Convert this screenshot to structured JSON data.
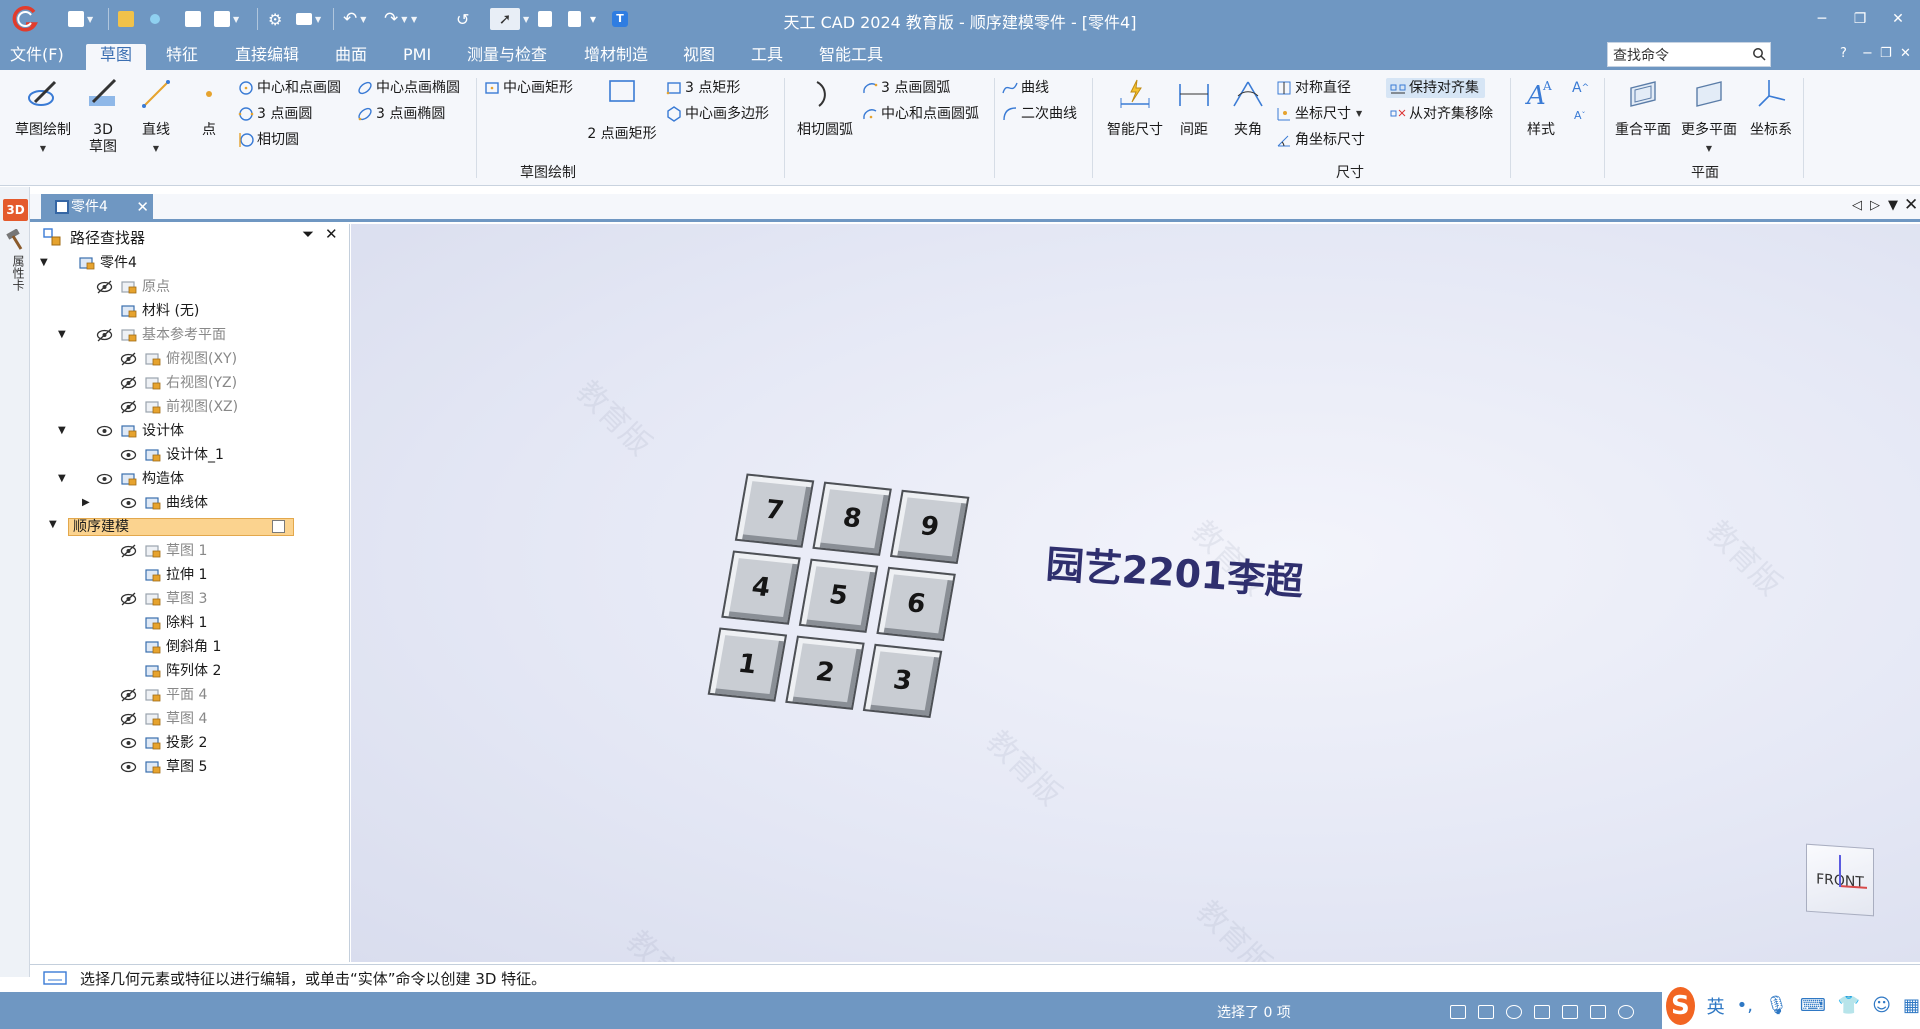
{
  "titlebar": {
    "title": "天工 CAD 2024 教育版 - 顺序建模零件 - [零件4]",
    "window_controls": [
      "minimize",
      "restore",
      "close"
    ]
  },
  "menu": {
    "file": "文件(F)",
    "tabs": [
      "草图",
      "特征",
      "直接编辑",
      "曲面",
      "PMI",
      "测量与检查",
      "增材制造",
      "视图",
      "工具",
      "智能工具"
    ],
    "active_tab": "草图",
    "search_placeholder": "查找命令",
    "help": "?"
  },
  "ribbon": {
    "sketch_draw": {
      "label": "草图绘制",
      "big": [
        {
          "id": "sketch",
          "label": "草图绘制"
        },
        {
          "id": "3d",
          "label": "3D\n草图"
        },
        {
          "id": "line",
          "label": "直线"
        },
        {
          "id": "point",
          "label": "点"
        }
      ],
      "circle_small": [
        "中心和点画圆",
        "3 点画圆",
        "相切圆"
      ],
      "ellipse_small": [
        "中心点画椭圆",
        "3 点画椭圆"
      ],
      "rect_small": [
        "中心画矩形"
      ],
      "rect_big": "2 点画矩形",
      "rect_more": [
        "3 点矩形",
        "中心画多边形"
      ],
      "arc_big": "相切圆弧",
      "arc_small": [
        "3 点画圆弧",
        "中心和点画圆弧"
      ],
      "curve_small": [
        "曲线",
        "二次曲线"
      ]
    },
    "dimension": {
      "label": "尺寸",
      "big": [
        "智能尺寸",
        "间距",
        "夹角"
      ],
      "small": [
        "对称直径",
        "坐标尺寸",
        "角坐标尺寸"
      ],
      "align": [
        "保持对齐集",
        "从对齐集移除"
      ]
    },
    "style": {
      "label": "样式"
    },
    "plane": {
      "label": "平面",
      "big": [
        "重合平面",
        "更多平面",
        "坐标系"
      ]
    }
  },
  "left_rail": {
    "badge": "3D",
    "label": "属性卡"
  },
  "doc_tab": {
    "name": "零件4"
  },
  "pathfinder": {
    "title": "路径查找器",
    "tree": [
      {
        "label": "零件4",
        "depth": 0,
        "exp": "▼",
        "eye": "none",
        "muted": false
      },
      {
        "label": "原点",
        "depth": 1,
        "exp": "",
        "eye": "hidden",
        "muted": true
      },
      {
        "label": "材料 (无)",
        "depth": 1,
        "exp": "",
        "eye": "none",
        "muted": false
      },
      {
        "label": "基本参考平面",
        "depth": 1,
        "exp": "▼",
        "eye": "hidden",
        "muted": true
      },
      {
        "label": "俯视图(XY)",
        "depth": 2,
        "exp": "",
        "eye": "hidden",
        "muted": true
      },
      {
        "label": "右视图(YZ)",
        "depth": 2,
        "exp": "",
        "eye": "hidden",
        "muted": true
      },
      {
        "label": "前视图(XZ)",
        "depth": 2,
        "exp": "",
        "eye": "hidden",
        "muted": true
      },
      {
        "label": "设计体",
        "depth": 1,
        "exp": "▼",
        "eye": "visible",
        "muted": false
      },
      {
        "label": "设计体_1",
        "depth": 2,
        "exp": "",
        "eye": "visible",
        "muted": false
      },
      {
        "label": "构造体",
        "depth": 1,
        "exp": "▼",
        "eye": "visible",
        "muted": false
      },
      {
        "label": "曲线体",
        "depth": 2,
        "exp": "▶",
        "eye": "visible",
        "muted": false
      },
      {
        "label": "顺序建模",
        "depth": 1,
        "exp": "▼",
        "eye": "none",
        "muted": false,
        "selected": true
      },
      {
        "label": "草图 1",
        "depth": 2,
        "exp": "",
        "eye": "hidden",
        "muted": true
      },
      {
        "label": "拉伸 1",
        "depth": 2,
        "exp": "",
        "eye": "none",
        "muted": false
      },
      {
        "label": "草图 3",
        "depth": 2,
        "exp": "",
        "eye": "hidden",
        "muted": true
      },
      {
        "label": "除料 1",
        "depth": 2,
        "exp": "",
        "eye": "none",
        "muted": false
      },
      {
        "label": "倒斜角 1",
        "depth": 2,
        "exp": "",
        "eye": "none",
        "muted": false
      },
      {
        "label": "阵列体 2",
        "depth": 2,
        "exp": "",
        "eye": "none",
        "muted": false
      },
      {
        "label": "平面 4",
        "depth": 2,
        "exp": "",
        "eye": "hidden",
        "muted": true
      },
      {
        "label": "草图 4",
        "depth": 2,
        "exp": "",
        "eye": "hidden",
        "muted": true
      },
      {
        "label": "投影 2",
        "depth": 2,
        "exp": "",
        "eye": "visible",
        "muted": false
      },
      {
        "label": "草图 5",
        "depth": 2,
        "exp": "",
        "eye": "visible",
        "muted": false
      }
    ]
  },
  "viewport": {
    "watermark": "教育版",
    "keys": [
      "7",
      "8",
      "9",
      "4",
      "5",
      "6",
      "1",
      "2",
      "3"
    ],
    "model_text": "园艺2201李超",
    "view_cube": "FRONT"
  },
  "prompt": "选择几何元素或特征以进行编辑，或单击“实体”命令以创建 3D 特征。",
  "status": {
    "selection": "选择了 0 项"
  },
  "ime": {
    "logo": "S",
    "lang": "英"
  },
  "colors": {
    "accent": "#6f97c2",
    "selected": "#fbd38f",
    "ime": "#f26522"
  }
}
